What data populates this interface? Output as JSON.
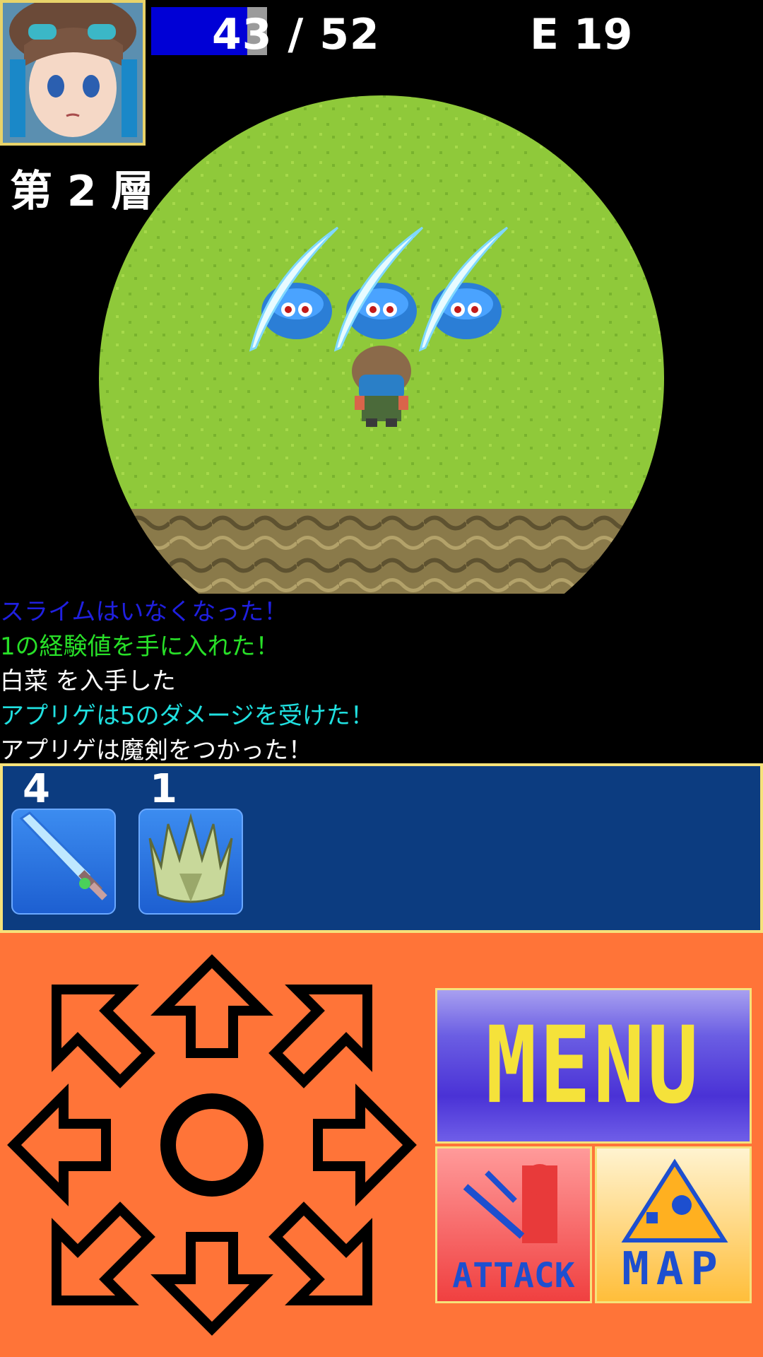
{
  "hud": {
    "hp_current": 43,
    "hp_max": 52,
    "hp_text": "43 / 52",
    "energy_text": "E 19",
    "floor_text": "第 2 層"
  },
  "log": [
    {
      "text": "スライムはいなくなった！",
      "color": "#2020e0"
    },
    {
      "text": "1の経験値を手に入れた！",
      "color": "#28e028"
    },
    {
      "text": "白菜 を入手した",
      "color": "#ffffff"
    },
    {
      "text": "アプリゲは5のダメージを受けた！",
      "color": "#20e0e0"
    },
    {
      "text": "アプリゲは魔剣をつかった！",
      "color": "#ffffff"
    }
  ],
  "inventory": [
    {
      "count": "4",
      "icon": "magic-sword-icon"
    },
    {
      "count": "1",
      "icon": "cabbage-icon"
    }
  ],
  "controls": {
    "menu_label": "MENU",
    "attack_label": "ATTACK",
    "map_label": "MAP"
  },
  "colors": {
    "grass": "#8fc93a",
    "rock": "#8a7a4a",
    "control_bg": "#ff7438",
    "inventory_bg": "#0c3c80",
    "accent_border": "#f6e27a"
  }
}
